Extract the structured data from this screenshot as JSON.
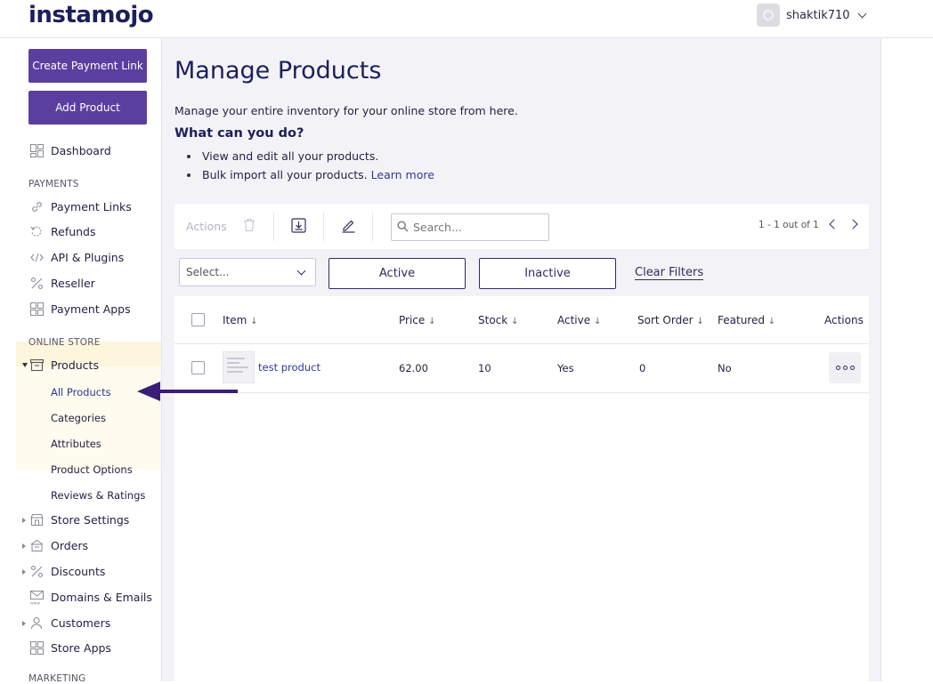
{
  "app": {
    "logo_text": "instamojo",
    "username": "shaktik710"
  },
  "sidebar": {
    "create_payment_link": "Create Payment Link",
    "add_product": "Add Product",
    "dashboard": "Dashboard",
    "payments_label": "PAYMENTS",
    "payment_items": [
      "Payment Links",
      "Refunds",
      "API & Plugins",
      "Reseller",
      "Payment Apps"
    ],
    "online_store_label": "ONLINE STORE",
    "products": "Products",
    "product_subitems": [
      "All Products",
      "Categories",
      "Attributes",
      "Product Options",
      "Reviews & Ratings"
    ],
    "store_items": [
      "Store Settings",
      "Orders",
      "Discounts",
      "Domains & Emails",
      "Customers",
      "Store Apps"
    ],
    "marketing_label": "MARKETING",
    "active_item": "All Products"
  },
  "main": {
    "title": "Manage Products",
    "description": "Manage your entire inventory for your online store from here.",
    "what_heading": "What can you do?",
    "bullet_1": "View and edit all your products.",
    "bullet_2": "Bulk import all your products.",
    "learn_more": "Learn more"
  },
  "toolbar": {
    "actions_label": "Actions",
    "search_placeholder": "Search...",
    "pagination": "1 - 1 out of 1"
  },
  "filters": {
    "select_placeholder": "Select...",
    "active": "Active",
    "inactive": "Inactive",
    "clear": "Clear Filters"
  },
  "table": {
    "columns": [
      "Item",
      "Price",
      "Stock",
      "Active",
      "Sort Order",
      "Featured",
      "Actions"
    ],
    "rows": [
      {
        "item": "test product",
        "price": "62.00",
        "stock": "10",
        "active": "Yes",
        "sort_order": "0",
        "featured": "No"
      }
    ]
  },
  "colors": {
    "primary": "#5b3fa0",
    "navy": "#2d2d60",
    "title": "#1b1f5c",
    "active_bg": "#fdf5dc"
  }
}
